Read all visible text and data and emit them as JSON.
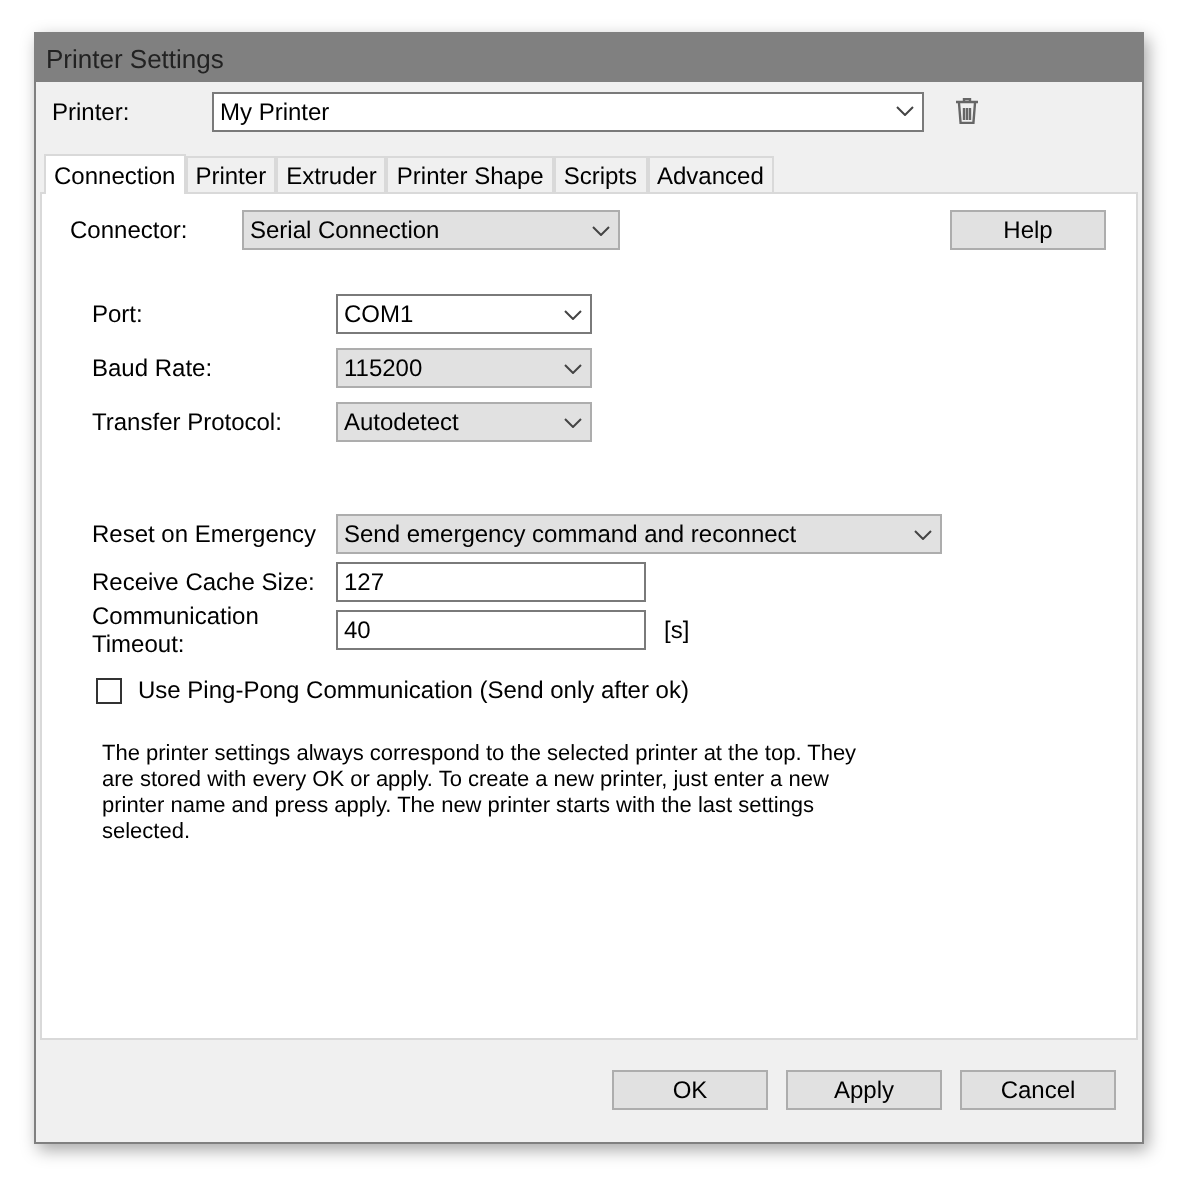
{
  "window": {
    "title": "Printer Settings"
  },
  "printer": {
    "label": "Printer:",
    "value": "My Printer"
  },
  "tabs": [
    {
      "label": "Connection",
      "selected": true
    },
    {
      "label": "Printer",
      "selected": false
    },
    {
      "label": "Extruder",
      "selected": false
    },
    {
      "label": "Printer Shape",
      "selected": false
    },
    {
      "label": "Scripts",
      "selected": false
    },
    {
      "label": "Advanced",
      "selected": false
    }
  ],
  "connector": {
    "label": "Connector:",
    "value": "Serial Connection"
  },
  "help_button": "Help",
  "serial_fields": [
    {
      "label": "Port:",
      "kind": "editable-combo",
      "value": "COM1"
    },
    {
      "label": "Baud Rate:",
      "kind": "combo",
      "value": "115200"
    },
    {
      "label": "Transfer Protocol:",
      "kind": "combo",
      "value": "Autodetect"
    }
  ],
  "behaviour_fields": [
    {
      "label": "Reset on Emergency",
      "kind": "wide-combo",
      "value": "Send emergency command and reconnect"
    },
    {
      "label": "Receive Cache Size:",
      "kind": "text",
      "value": "127"
    },
    {
      "label": "Communication Timeout:",
      "kind": "text",
      "value": "40",
      "unit": "[s]"
    }
  ],
  "ping_pong": {
    "label": "Use Ping-Pong Communication (Send only after ok)",
    "checked": false
  },
  "note": "The printer settings always correspond to the selected printer at the top. They are stored with every OK or apply. To create a new printer, just enter a new printer name and press apply. The new printer starts with the last settings selected.",
  "buttons": [
    "OK",
    "Apply",
    "Cancel"
  ]
}
